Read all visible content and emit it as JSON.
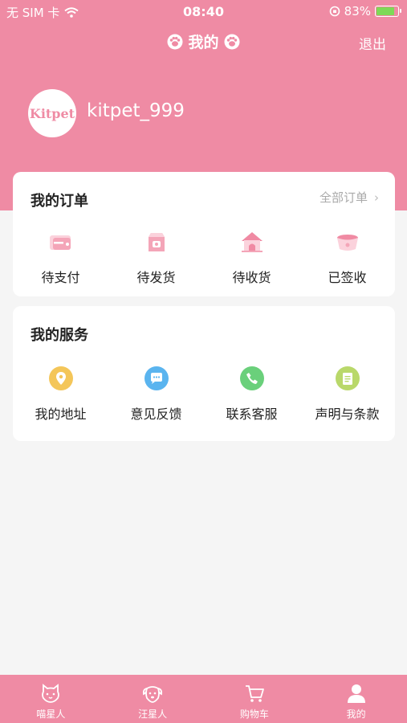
{
  "status_bar": {
    "carrier": "无 SIM 卡",
    "time": "08:40",
    "battery": "83%",
    "battery_level": 0.83
  },
  "nav": {
    "title": "我的",
    "logout_label": "退出"
  },
  "profile": {
    "avatar_text": "Kitpet",
    "username": "kitpet_999"
  },
  "orders": {
    "title": "我的订单",
    "all_label": "全部订单",
    "items": [
      {
        "label": "待支付",
        "icon": "wallet-icon"
      },
      {
        "label": "待发货",
        "icon": "package-icon"
      },
      {
        "label": "待收货",
        "icon": "pet-house-icon"
      },
      {
        "label": "已签收",
        "icon": "pet-bowl-icon"
      }
    ]
  },
  "services": {
    "title": "我的服务",
    "items": [
      {
        "label": "我的地址",
        "icon": "location-pin-icon",
        "color": "#f4c659"
      },
      {
        "label": "意见反馈",
        "icon": "chat-bubble-icon",
        "color": "#5ab4ef"
      },
      {
        "label": "联系客服",
        "icon": "phone-icon",
        "color": "#6ad07b"
      },
      {
        "label": "声明与条款",
        "icon": "document-icon",
        "color": "#b9d86a"
      }
    ]
  },
  "tab_bar": {
    "items": [
      {
        "label": "喵星人",
        "icon": "cat-icon"
      },
      {
        "label": "汪星人",
        "icon": "dog-icon"
      },
      {
        "label": "购物车",
        "icon": "cart-icon"
      },
      {
        "label": "我的",
        "icon": "user-icon"
      }
    ]
  },
  "colors": {
    "brand_pink": "#ef8ba4",
    "background": "#f5f5f5"
  }
}
